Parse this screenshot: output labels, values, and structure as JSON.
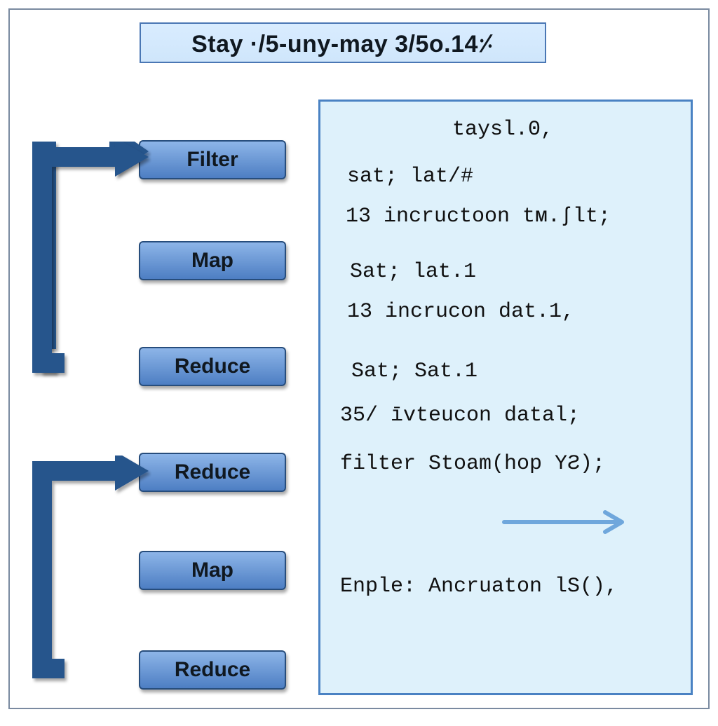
{
  "colors": {
    "box_gradient_top": "#8db5e8",
    "box_gradient_bottom": "#4d7ec3",
    "box_border": "#274d7c",
    "title_fill": "#cfe6fb",
    "title_border": "#4a77b4",
    "panel_fill": "#def1fb",
    "panel_border": "#4a82c3",
    "fat_arrow": "#28548c",
    "thin_arrow": "#7fb2e3"
  },
  "title": "Stay ·/5-uny-may 3/5o.14⸓",
  "ops": [
    "Filter",
    "Map",
    "Reduce",
    "Reduce",
    "Map",
    "Reduce"
  ],
  "code": {
    "line1": "taysl.0,",
    "line2": "sat; lat/#",
    "line3": "13 incructoon tᴍ.ʃlt;",
    "line4": "Sat; lat.1",
    "line5": "13 incrucon dat.1,",
    "line6": "Sat; Sat.1",
    "line7": "35/ īvteucon datal;",
    "line8": "filter Stoam(hop ҮƧ);",
    "line9": "Enple: Ancruaton lS(),"
  }
}
